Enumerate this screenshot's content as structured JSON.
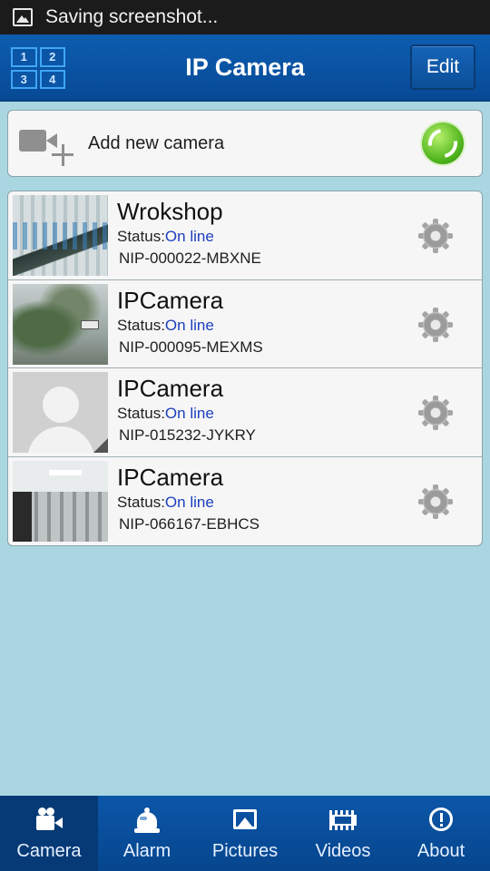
{
  "status_bar": {
    "text": "Saving screenshot..."
  },
  "header": {
    "title": "IP Camera",
    "edit_label": "Edit",
    "grid_labels": [
      "1",
      "2",
      "3",
      "4"
    ]
  },
  "add_camera": {
    "label": "Add new camera"
  },
  "cameras": [
    {
      "name": "Wrokshop",
      "status_label": "Status:",
      "status_value": "On line",
      "id": "NIP-000022-MBXNE"
    },
    {
      "name": "IPCamera",
      "status_label": "Status:",
      "status_value": "On line",
      "id": "NIP-000095-MEXMS"
    },
    {
      "name": "IPCamera",
      "status_label": "Status:",
      "status_value": "On line",
      "id": "NIP-015232-JYKRY"
    },
    {
      "name": "IPCamera",
      "status_label": "Status:",
      "status_value": "On line",
      "id": "NIP-066167-EBHCS"
    }
  ],
  "bottom_nav": [
    {
      "label": "Camera",
      "icon": "camera-icon",
      "active": true
    },
    {
      "label": "Alarm",
      "icon": "alarm-icon",
      "active": false
    },
    {
      "label": "Pictures",
      "icon": "pictures-icon",
      "active": false
    },
    {
      "label": "Videos",
      "icon": "videos-icon",
      "active": false
    },
    {
      "label": "About",
      "icon": "about-icon",
      "active": false
    }
  ],
  "colors": {
    "background": "#a9d6e1",
    "header": "#0d5db0",
    "status_online": "#1d3fbe",
    "nav_active": "#063a76"
  }
}
